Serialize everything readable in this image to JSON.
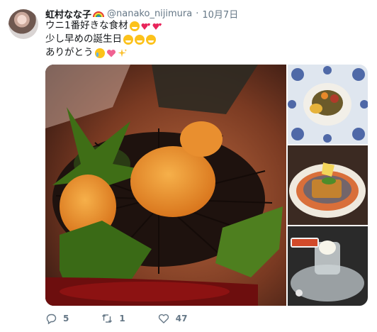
{
  "tweet": {
    "display_name": "虹村なな子",
    "handle": "@nanako_nijimura",
    "separator": "·",
    "date": "10月7日",
    "lines": [
      "ウニ1番好きな食材",
      "少し早めの誕生日",
      "ありがとう"
    ]
  },
  "actions": {
    "reply_count": "5",
    "retweet_count": "1",
    "like_count": "47"
  },
  "icons": {
    "name_badge": "rainbow-icon",
    "reply": "reply-icon",
    "retweet": "retweet-icon",
    "like": "heart-icon"
  },
  "colors": {
    "text": "#14171a",
    "muted": "#657786",
    "background": "#ffffff"
  }
}
